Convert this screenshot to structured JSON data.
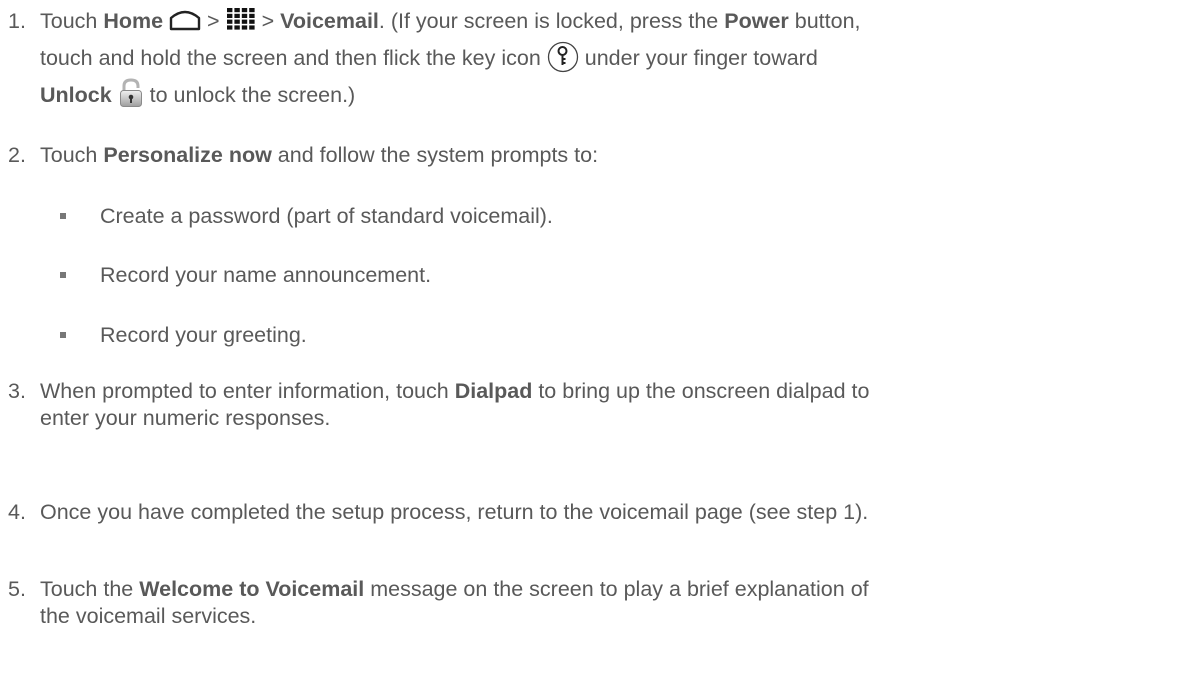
{
  "steps": [
    {
      "num": "1.",
      "parts": {
        "a": "Touch ",
        "home": "Home",
        "gt1": " > ",
        "gt2": " > ",
        "voicemail": "Voicemail",
        "b": ". (If your screen is locked, press the ",
        "power": "Power",
        "c": " button,",
        "d": "touch and hold the screen and then flick the key icon ",
        "e": " under your finger toward",
        "unlock": "Unlock",
        "f": " to unlock the screen.)"
      },
      "icons": [
        "home-icon",
        "apps-grid-icon",
        "key-icon",
        "lock-icon"
      ]
    },
    {
      "num": "2.",
      "parts": {
        "a": "Touch ",
        "personalize": "Personalize now",
        "b": " and follow the system prompts to:"
      }
    },
    {
      "num": "3.",
      "parts": {
        "a": "When prompted to enter information, touch ",
        "dialpad": "Dialpad",
        "b": " to bring up the onscreen dialpad to",
        "c": "enter your numeric responses."
      }
    },
    {
      "num": "4.",
      "parts": {
        "a": "Once you have completed the setup process, return to the voicemail page (see step 1)."
      }
    },
    {
      "num": "5.",
      "parts": {
        "a": "Touch the ",
        "welcome": "Welcome to Voicemail",
        "b": " message on the screen to play a brief explanation of",
        "c": "the voicemail services."
      }
    }
  ],
  "bullets": [
    "Create a password (part of standard voicemail).",
    "Record your name announcement.",
    "Record your greeting."
  ]
}
